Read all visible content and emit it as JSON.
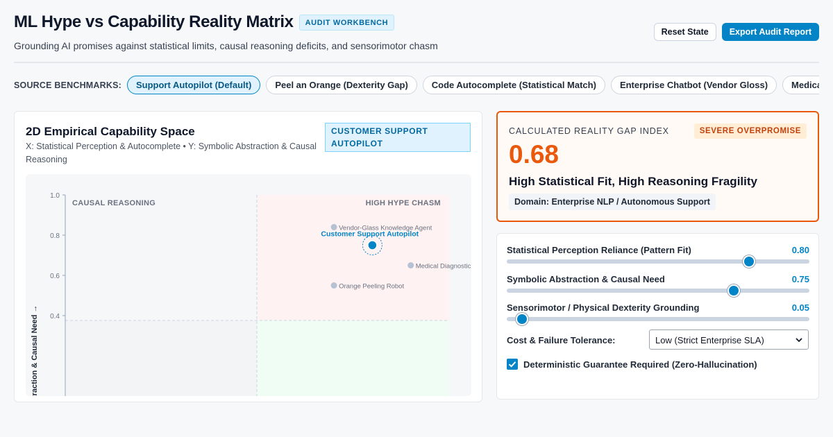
{
  "header": {
    "title": "ML Hype vs Capability Reality Matrix",
    "badge": "AUDIT WORKBENCH",
    "subtitle": "Grounding AI promises against statistical limits, causal reasoning deficits, and sensorimotor chasm",
    "reset_label": "Reset State",
    "export_label": "Export Audit Report"
  },
  "benchmarks": {
    "label": "SOURCE BENCHMARKS:",
    "items": [
      {
        "label": "Support Autopilot (Default)",
        "active": true
      },
      {
        "label": "Peel an Orange (Dexterity Gap)",
        "active": false
      },
      {
        "label": "Code Autocomplete (Statistical Match)",
        "active": false
      },
      {
        "label": "Enterprise Chatbot (Vendor Gloss)",
        "active": false
      },
      {
        "label": "Medical Imaging Diagnostic",
        "active": false
      }
    ]
  },
  "capability_space": {
    "title": "2D Empirical Capability Space",
    "description": "X: Statistical Perception & Autocomplete • Y: Symbolic Abstraction & Causal Reasoning",
    "scope_badge": "CUSTOMER SUPPORT AUTOPILOT",
    "quadrant_top_left": "CAUSAL REASONING",
    "quadrant_top_right": "HIGH HYPE CHASM",
    "y_axis_label": "Symbolic Abstraction & Causal Need →"
  },
  "chart_data": {
    "type": "scatter",
    "ylim": [
      0,
      1.0
    ],
    "xlim": [
      0,
      1.0
    ],
    "y_ticks": [
      "1.0",
      "0.8",
      "0.6",
      "0.4"
    ],
    "highlight": {
      "label": "Customer Support Autopilot",
      "x": 0.8,
      "y": 0.75
    },
    "points": [
      {
        "label": "Vendor-Glass Knowledge Agent",
        "x": 0.7,
        "y": 0.84
      },
      {
        "label": "Medical Diagnostic",
        "x": 0.9,
        "y": 0.65
      },
      {
        "label": "Orange Peeling Robot",
        "x": 0.7,
        "y": 0.55
      }
    ]
  },
  "gap": {
    "label": "CALCULATED REALITY GAP INDEX",
    "badge": "SEVERE OVERPROMISE",
    "value": "0.68",
    "headline": "High Statistical Fit, High Reasoning Fragility",
    "domain": "Domain: Enterprise NLP / Autonomous Support"
  },
  "controls": {
    "sliders": [
      {
        "label": "Statistical Perception Reliance (Pattern Fit)",
        "value": 0.8,
        "display": "0.80"
      },
      {
        "label": "Symbolic Abstraction & Causal Need",
        "value": 0.75,
        "display": "0.75"
      },
      {
        "label": "Sensorimotor / Physical Dexterity Grounding",
        "value": 0.05,
        "display": "0.05"
      }
    ],
    "tolerance_label": "Cost & Failure Tolerance:",
    "tolerance_value": "Low (Strict Enterprise SLA)",
    "deterministic_label": "Deterministic Guarantee Required (Zero-Hallucination)",
    "deterministic_checked": true
  },
  "colors": {
    "accent": "#0284c7",
    "warning": "#ea580c"
  }
}
